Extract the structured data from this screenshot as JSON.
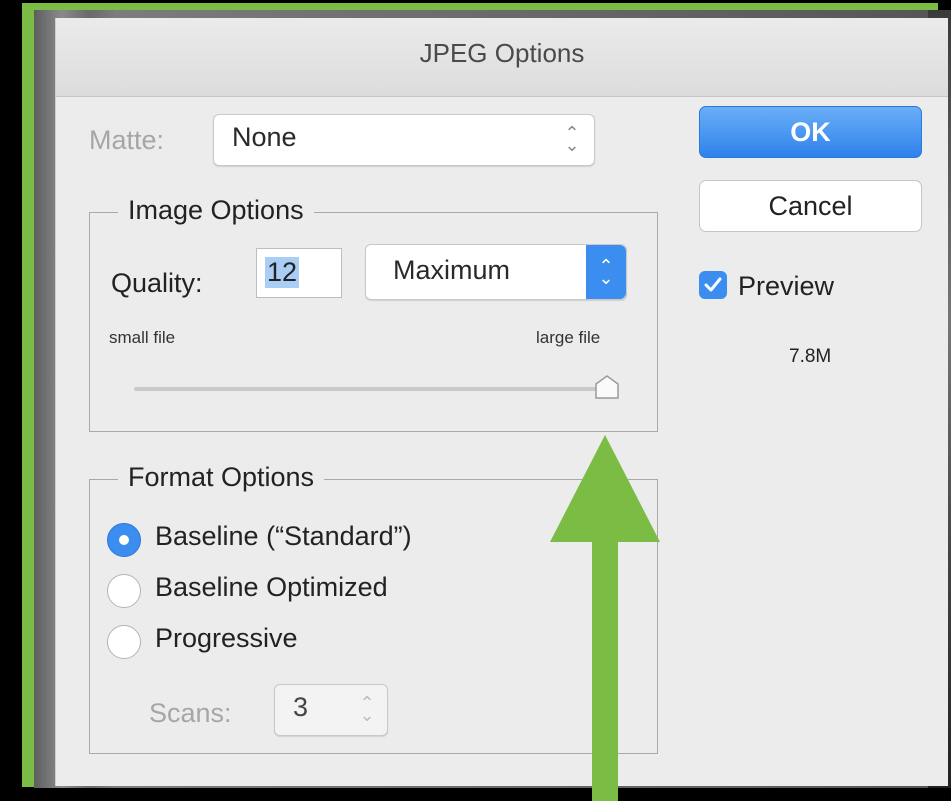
{
  "dialog": {
    "title": "JPEG Options"
  },
  "matte": {
    "label": "Matte:",
    "value": "None"
  },
  "image_options": {
    "title": "Image Options",
    "quality_label": "Quality:",
    "quality_value": "12",
    "quality_preset": "Maximum",
    "small_file_label": "small file",
    "large_file_label": "large file",
    "slider_fraction": 1.0
  },
  "format_options": {
    "title": "Format Options",
    "baseline_standard": "Baseline (“Standard”)",
    "baseline_optimized": "Baseline Optimized",
    "progressive": "Progressive",
    "scans_label": "Scans:",
    "scans_value": "3",
    "selected": "baseline_standard"
  },
  "buttons": {
    "ok": "OK",
    "cancel": "Cancel"
  },
  "preview": {
    "label": "Preview",
    "checked": true,
    "file_size": "7.8M"
  },
  "colors": {
    "accent": "#3b8ef0",
    "annotation_arrow": "#7bbc44"
  }
}
